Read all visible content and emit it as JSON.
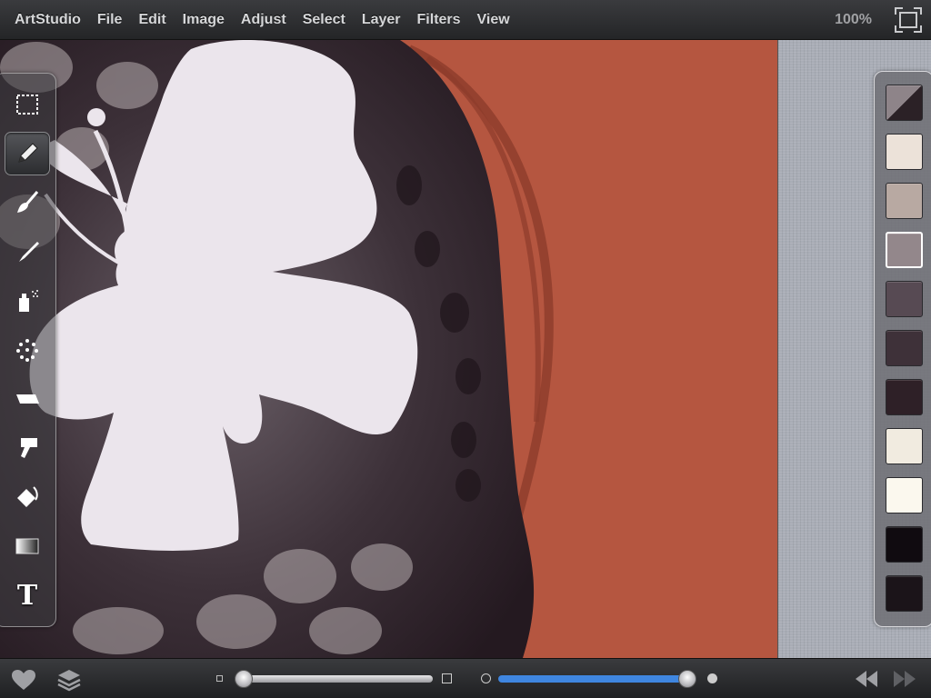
{
  "menu": {
    "app": "ArtStudio",
    "items": [
      "File",
      "Edit",
      "Image",
      "Adjust",
      "Select",
      "Layer",
      "Filters",
      "View"
    ],
    "zoom": "100%"
  },
  "tools": [
    {
      "name": "selection-tool",
      "icon": "dashed-rectangle-icon"
    },
    {
      "name": "pencil-tool",
      "icon": "pencil-icon",
      "selected": true
    },
    {
      "name": "brush-tool",
      "icon": "paintbrush-icon"
    },
    {
      "name": "smudge-tool",
      "icon": "smudge-icon"
    },
    {
      "name": "spray-tool",
      "icon": "spray-can-icon"
    },
    {
      "name": "scatter-tool",
      "icon": "dots-icon"
    },
    {
      "name": "eraser-tool",
      "icon": "eraser-icon"
    },
    {
      "name": "stamp-tool",
      "icon": "stamp-icon"
    },
    {
      "name": "fill-tool",
      "icon": "paint-bucket-icon"
    },
    {
      "name": "gradient-tool",
      "icon": "gradient-icon"
    },
    {
      "name": "text-tool",
      "icon": "text-icon",
      "label": "T"
    }
  ],
  "palette": {
    "swatches": [
      "#8e8489",
      "#ece2d9",
      "#b8a9a2",
      "#93878b",
      "#574a53",
      "#3e3139",
      "#2e2027",
      "#f1ebe0",
      "#fbf8ee",
      "#100b10",
      "#1b1419"
    ],
    "primary": "#8e8489",
    "secondary": "#2b2126",
    "selected_index": 3
  },
  "sliders": {
    "size_value": 0.0,
    "opacity_value": 1.0,
    "opacity_color": "#3f86e0"
  },
  "colors": {
    "canvas_background": "#b55640"
  }
}
